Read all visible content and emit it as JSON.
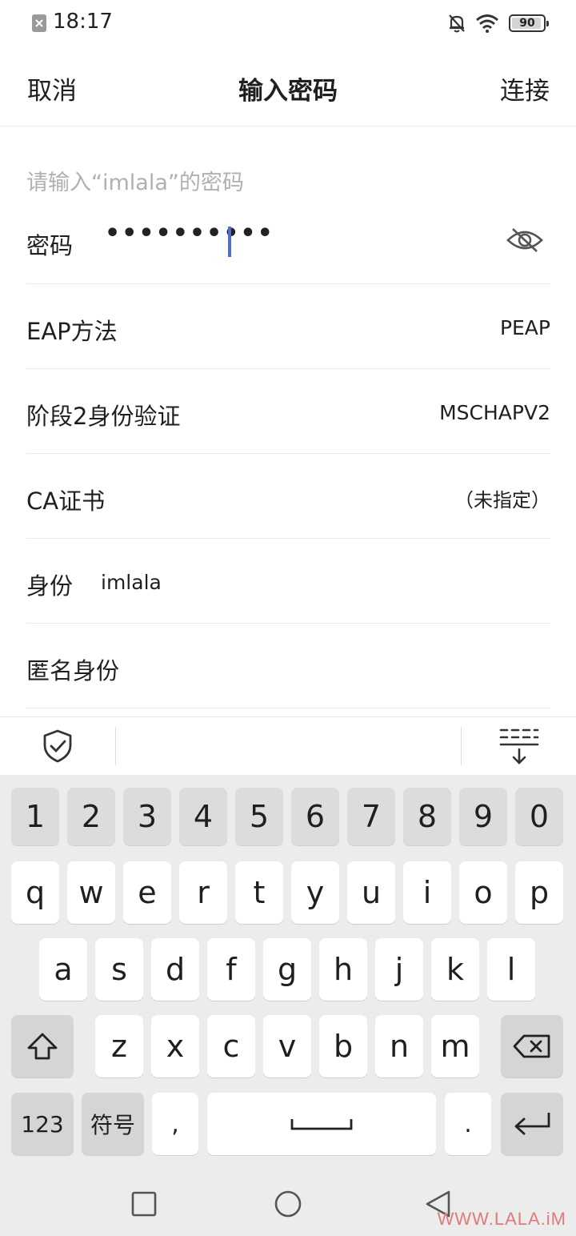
{
  "status_bar": {
    "time": "18:17",
    "battery_level": "90",
    "icons": [
      "notification-icon",
      "mute-bell-icon",
      "wifi-icon",
      "battery-icon"
    ]
  },
  "header": {
    "cancel": "取消",
    "title": "输入密码",
    "connect": "连接"
  },
  "form": {
    "prompt": "请输入“imlala”的密码",
    "password": {
      "label": "密码",
      "masked_value": "••••••••••"
    },
    "eap_method": {
      "label": "EAP方法",
      "value": "PEAP"
    },
    "phase2": {
      "label": "阶段2身份验证",
      "value": "MSCHAPV2"
    },
    "ca_cert": {
      "label": "CA证书",
      "value": "（未指定）"
    },
    "identity": {
      "label": "身份",
      "value": "imlala"
    },
    "anonymous_identity": {
      "label": "匿名身份"
    }
  },
  "keyboard": {
    "number_row": [
      "1",
      "2",
      "3",
      "4",
      "5",
      "6",
      "7",
      "8",
      "9",
      "0"
    ],
    "row1": [
      "q",
      "w",
      "e",
      "r",
      "t",
      "y",
      "u",
      "i",
      "o",
      "p"
    ],
    "row2": [
      "a",
      "s",
      "d",
      "f",
      "g",
      "h",
      "j",
      "k",
      "l"
    ],
    "row3": [
      "z",
      "x",
      "c",
      "v",
      "b",
      "n",
      "m"
    ],
    "bottom": {
      "numeric": "123",
      "symbols": "符号",
      "comma": ",",
      "period": "."
    }
  },
  "watermark": "WWW.LALA.iM",
  "colors": {
    "caret": "#4a6fd6",
    "keyboard_bg": "#ececec",
    "number_key_bg": "#dcdcdc",
    "watermark": "#e07a7a"
  }
}
